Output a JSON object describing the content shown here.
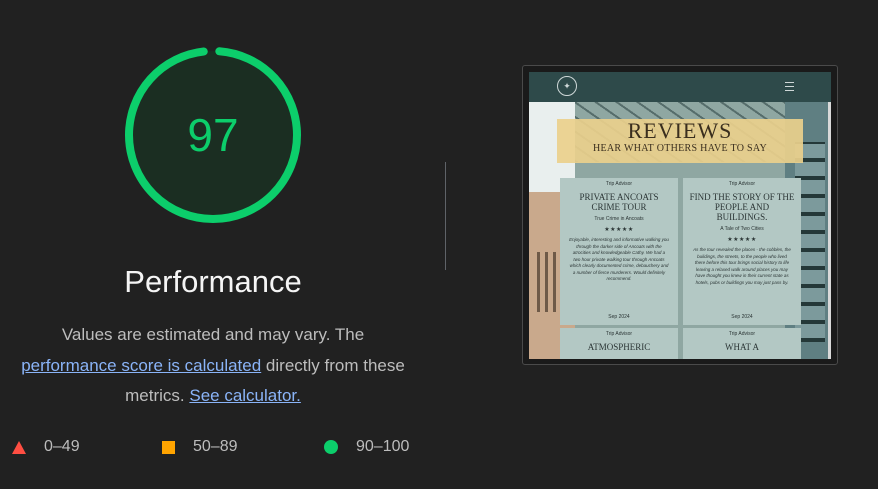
{
  "gauge": {
    "score": "97",
    "value_fraction": 0.97,
    "color": "#0cce6b",
    "track_color": "#1b2e22"
  },
  "title": "Performance",
  "description": {
    "line1": "Values are estimated and may vary. The",
    "link1": "performance score is calculated",
    "mid": " directly from these metrics. ",
    "link2": "See calculator."
  },
  "legend": [
    {
      "shape": "triangle-icon",
      "color": "#ff4e42",
      "label": "0–49"
    },
    {
      "shape": "square-icon",
      "color": "#ffa400",
      "label": "50–89"
    },
    {
      "shape": "circle-icon",
      "color": "#0cce6b",
      "label": "90–100"
    }
  ],
  "screenshot": {
    "banner_title": "REVIEWS",
    "banner_subtitle": "HEAR WHAT OTHERS HAVE TO SAY",
    "cards": [
      {
        "source": "Trip Advisor",
        "title": "Private Ancoats Crime Tour",
        "sub": "True Crime in Ancoats",
        "stars": "★★★★★",
        "body": "Enjoyable, interesting and informative walking you through the darker side of Ancoats with the atrocities and knowledgeable Cathy. We had a two hour private walking tour through Ancoats which clearly documented crime, debauchery and a number of fierce murderers. Would definitely recommend.",
        "date": "Sep 2024"
      },
      {
        "source": "Trip Advisor",
        "title": "Find the story of the people and buildings.",
        "sub": "A Tale of Two Cities",
        "stars": "★★★★★",
        "body": "As the tour revealed the places - the cobbles, the buildings, the streets, to the people who lived there before this tour brings social history to life leaving a relaxed walk around places you may have thought you knew in their current state as hotels, pubs or buildings you may just pass by.",
        "date": "Sep 2024"
      },
      {
        "source": "Trip Advisor",
        "title": "Atmospheric",
        "sub": "",
        "stars": "",
        "body": "",
        "date": ""
      },
      {
        "source": "Trip Advisor",
        "title": "What a",
        "sub": "",
        "stars": "",
        "body": "",
        "date": ""
      }
    ]
  }
}
